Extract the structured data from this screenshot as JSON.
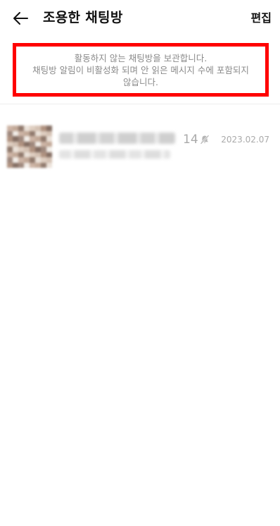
{
  "header": {
    "title": "조용한 채팅방",
    "edit_label": "편집",
    "back_icon": "arrow-left-icon"
  },
  "notice": {
    "line1": "활동하지 않는 채팅방을 보관합니다.",
    "line2": "채팅방 알림이 비활성화 되며 안 읽은 메시지 수에 포함되지",
    "line3": "않습니다.",
    "highlight_color": "#ff0000"
  },
  "chats": [
    {
      "name": "",
      "preview": "",
      "member_count": "14",
      "muted": true,
      "mute_icon": "bell-off-icon",
      "date": "2023.02.07"
    }
  ],
  "colors": {
    "text": "#111111",
    "muted_text": "#aaaaaa",
    "notice_text": "#8a8a8a",
    "divider": "#eeeeee"
  }
}
